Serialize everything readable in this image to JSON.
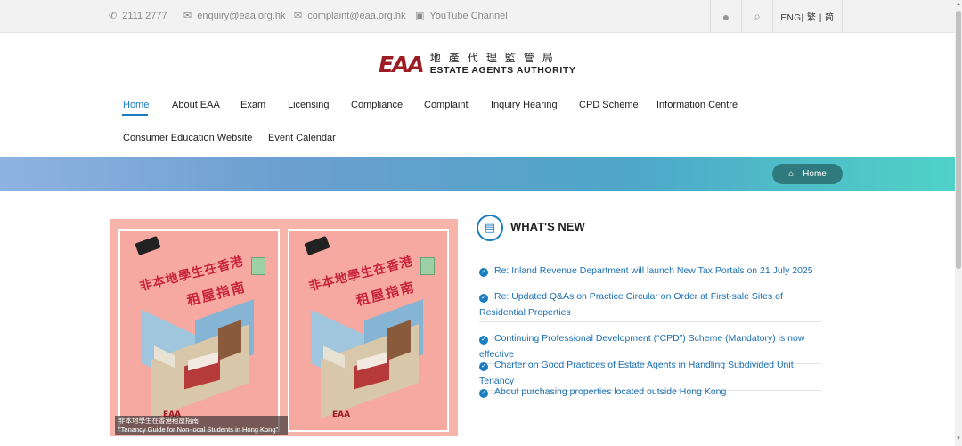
{
  "topbar": {
    "phone": "2111 2777",
    "enquiry_email": "enquiry@eaa.org.hk",
    "complaint_email": "complaint@eaa.org.hk",
    "youtube": "YouTube Channel",
    "lang": "ENG| 繁 | 简"
  },
  "logo": {
    "mark": "EAA",
    "zh": "地產代理監管局",
    "en": "ESTATE AGENTS AUTHORITY"
  },
  "nav": {
    "items": [
      "Home",
      "About EAA",
      "Exam",
      "Licensing",
      "Compliance",
      "Complaint",
      "Inquiry Hearing",
      "CPD Scheme",
      "Information Centre",
      "Consumer Education Website",
      "Event Calendar"
    ],
    "active": "Home"
  },
  "breadcrumb": {
    "label": "Home"
  },
  "feature": {
    "poster_title_zh_1": "非本地學生在香港",
    "poster_title_zh_2": "租屋指南",
    "poster_logo": "EAA",
    "caption_zh": "非本地學生在香港租屋指南",
    "caption_en": "\"Tenancy Guide for Non-local Students in Hong Kong\""
  },
  "whats_new": {
    "title": "WHAT'S NEW",
    "items": [
      "Re: Inland Revenue Department will launch New Tax Portals on 21 July 2025",
      "Re: Updated Q&As on Practice Circular on Order at First-sale Sites of Residential Properties",
      "Continuing Professional Development (“CPD”) Scheme (Mandatory) is now effective",
      "Charter on Good Practices of Estate Agents in Handling Subdivided Unit Tenancy",
      "About purchasing properties located outside Hong Kong"
    ]
  },
  "colors": {
    "accent": "#1a7dc0",
    "brand": "#9b1c23",
    "breadcrumb_pill": "#2f7a7d"
  }
}
